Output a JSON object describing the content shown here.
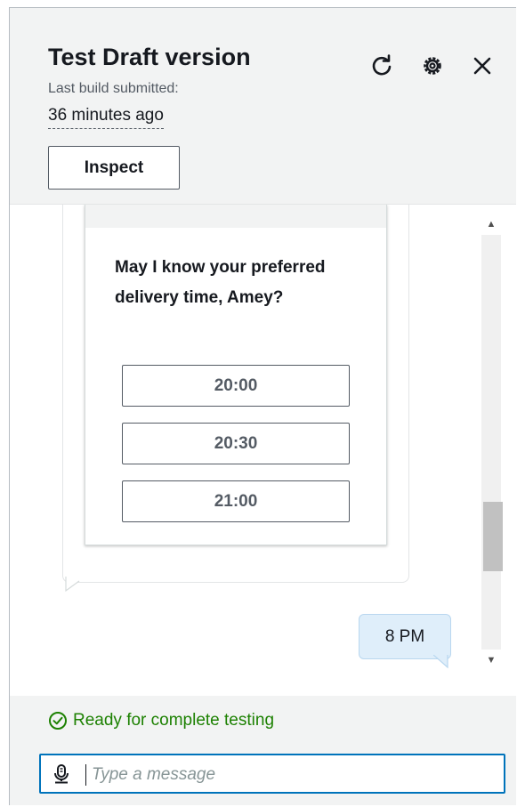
{
  "header": {
    "title": "Test Draft version",
    "subtitle": "Last build submitted:",
    "time_ago": "36 minutes ago",
    "inspect_label": "Inspect"
  },
  "chat": {
    "bot_question": "May I know your preferred delivery time, Amey?",
    "options": [
      "20:00",
      "20:30",
      "21:00"
    ],
    "user_reply": "8 PM"
  },
  "footer": {
    "status": "Ready for complete testing",
    "input_placeholder": "Type a message"
  },
  "icons": {
    "refresh": "refresh-icon",
    "settings": "gear-icon",
    "close": "close-icon",
    "status": "check-circle-icon",
    "mic": "microphone-icon"
  },
  "colors": {
    "status_green": "#1d8102",
    "input_focus": "#0073bb",
    "user_bubble": "#dfeefa"
  }
}
